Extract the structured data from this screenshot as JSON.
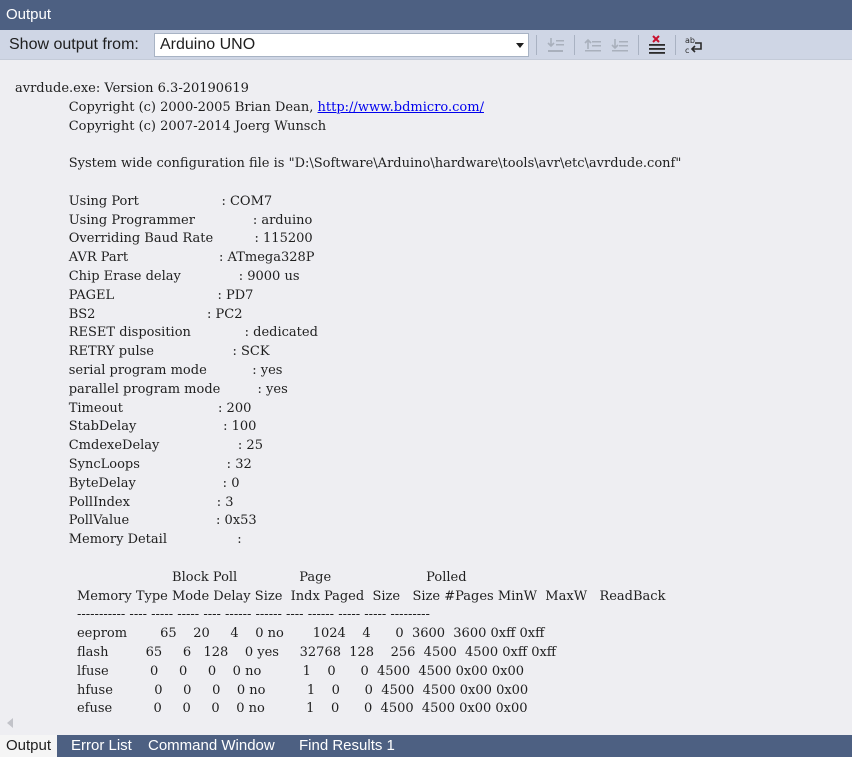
{
  "window": {
    "title": "Output"
  },
  "toolbar": {
    "show_output_label": "Show output from:",
    "source_selected": "Arduino UNO",
    "buttons": [
      "go-to-previous-message-icon",
      "find-message-in-code-icon",
      "go-to-next-message-icon",
      "clear-all-icon",
      "toggle-word-wrap-icon"
    ]
  },
  "output": {
    "lines": [
      {
        "text": "avrdude.exe: Version 6.3-20190619"
      },
      {
        "text": "             Copyright (c) 2000-2005 Brian Dean, ",
        "link": "http://www.bdmicro.com/"
      },
      {
        "text": "             Copyright (c) 2007-2014 Joerg Wunsch"
      },
      {
        "text": ""
      },
      {
        "text": "             System wide configuration file is \"D:\\Software\\Arduino\\hardware\\tools\\avr\\etc\\avrdude.conf\""
      },
      {
        "text": ""
      },
      {
        "text": "             Using Port                    : COM7"
      },
      {
        "text": "             Using Programmer              : arduino"
      },
      {
        "text": "             Overriding Baud Rate          : 115200"
      },
      {
        "text": "             AVR Part                      : ATmega328P"
      },
      {
        "text": "             Chip Erase delay              : 9000 us"
      },
      {
        "text": "             PAGEL                         : PD7"
      },
      {
        "text": "             BS2                           : PC2"
      },
      {
        "text": "             RESET disposition             : dedicated"
      },
      {
        "text": "             RETRY pulse                   : SCK"
      },
      {
        "text": "             serial program mode           : yes"
      },
      {
        "text": "             parallel program mode         : yes"
      },
      {
        "text": "             Timeout                       : 200"
      },
      {
        "text": "             StabDelay                     : 100"
      },
      {
        "text": "             CmdexeDelay                   : 25"
      },
      {
        "text": "             SyncLoops                     : 32"
      },
      {
        "text": "             ByteDelay                     : 0"
      },
      {
        "text": "             PollIndex                     : 3"
      },
      {
        "text": "             PollValue                     : 0x53"
      },
      {
        "text": "             Memory Detail                 :"
      },
      {
        "text": ""
      },
      {
        "text": "                                      Block Poll               Page                       Polled"
      },
      {
        "text": "               Memory Type Mode Delay Size  Indx Paged  Size   Size #Pages MinW  MaxW   ReadBack"
      },
      {
        "text": "               ----------- ---- ----- ----- ---- ------ ------ ---- ------ ----- ----- ---------"
      },
      {
        "text": "               eeprom        65    20     4    0 no       1024    4      0  3600  3600 0xff 0xff"
      },
      {
        "text": "               flash         65     6   128    0 yes     32768  128    256  4500  4500 0xff 0xff"
      },
      {
        "text": "               lfuse          0     0     0    0 no          1    0      0  4500  4500 0x00 0x00"
      },
      {
        "text": "               hfuse          0     0     0    0 no          1    0      0  4500  4500 0x00 0x00"
      },
      {
        "text": "               efuse          0     0     0    0 no          1    0      0  4500  4500 0x00 0x00"
      }
    ]
  },
  "tabs": [
    {
      "label": "Output",
      "active": true
    },
    {
      "label": "Error List",
      "active": false
    },
    {
      "label": "Command Window",
      "active": false
    },
    {
      "label": "Find Results 1",
      "active": false
    }
  ],
  "colors": {
    "title_bar": "#4d6082",
    "toolbar": "#cfd6e5",
    "output_background": "#eeeef2",
    "link": "#0000ee"
  }
}
